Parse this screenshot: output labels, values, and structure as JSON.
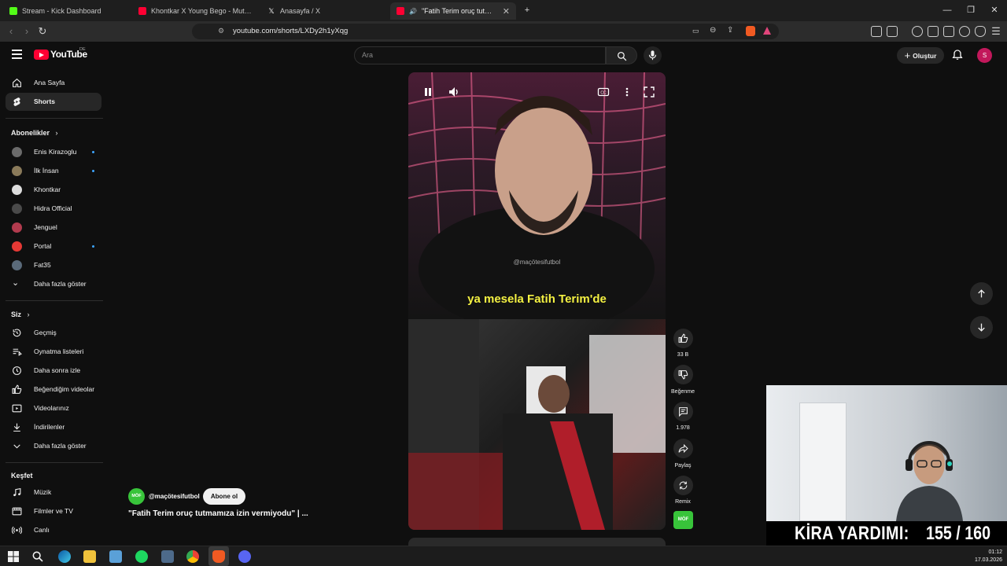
{
  "browser": {
    "tabs": [
      {
        "title": "Stream - Kick Dashboard",
        "color": "#53fc18"
      },
      {
        "title": "Khontkar X Young Bego - Mutfak I &",
        "color": "#ff0033"
      },
      {
        "title": "Anasayfa / X",
        "color": "#ffffff"
      },
      {
        "title": "\"Fatih Terim oruç tutmamıza i",
        "color": "#ff0033"
      }
    ],
    "url": "youtube.com/shorts/LXDy2h1yXqg"
  },
  "header": {
    "logo_text": "YouTube",
    "country": "DE",
    "search_placeholder": "Ara",
    "create_label": "Oluştur",
    "avatar_letter": "S"
  },
  "sidebar": {
    "main": [
      {
        "label": "Ana Sayfa",
        "icon": "home-icon"
      },
      {
        "label": "Shorts",
        "icon": "shorts-icon"
      }
    ],
    "subs_title": "Abonelikler",
    "subscriptions": [
      {
        "label": "Enis Kirazoglu",
        "dot": true,
        "color": "#6b6b6b"
      },
      {
        "label": "İlk İnsan",
        "dot": true,
        "color": "#8a7a5a"
      },
      {
        "label": "Khontkar",
        "dot": false,
        "color": "#dddddd"
      },
      {
        "label": "Hidra Official",
        "dot": false,
        "color": "#4a4a4a"
      },
      {
        "label": "Jenguel",
        "dot": false,
        "color": "#b23b4e"
      },
      {
        "label": "Portal",
        "dot": true,
        "color": "#e53935"
      },
      {
        "label": "Fat35",
        "dot": false,
        "color": "#5a6a7a"
      }
    ],
    "subs_more": "Daha fazla göster",
    "you_title": "Siz",
    "you_items": [
      {
        "label": "Geçmiş",
        "icon": "history-icon"
      },
      {
        "label": "Oynatma listeleri",
        "icon": "playlist-icon"
      },
      {
        "label": "Daha sonra izle",
        "icon": "clock-icon"
      },
      {
        "label": "Beğendiğim videolar",
        "icon": "like-icon"
      },
      {
        "label": "Videolarınız",
        "icon": "video-icon"
      },
      {
        "label": "İndirilenler",
        "icon": "download-icon"
      },
      {
        "label": "Daha fazla göster",
        "icon": "chevron-down-icon"
      }
    ],
    "explore_title": "Keşfet",
    "explore_items": [
      {
        "label": "Müzik",
        "icon": "music-icon"
      },
      {
        "label": "Filmler ve TV",
        "icon": "film-icon"
      },
      {
        "label": "Canlı",
        "icon": "live-icon"
      }
    ]
  },
  "short": {
    "watermark": "@maçötesifutbol",
    "subtitle": "ya mesela Fatih Terim'de",
    "channel": "@maçötesifutbol",
    "channel_badge": "MÖF",
    "subscribe_label": "Abone ol",
    "title": "\"Fatih Terim oruç tutmamıza izin vermiyodu\" | ...",
    "actions": {
      "like_count": "33 B",
      "dislike_label": "Beğenme",
      "comment_count": "1.978",
      "share_label": "Paylaş",
      "remix_label": "Remix"
    }
  },
  "overlay": {
    "kira_label": "KİRA YARDIMI:",
    "kira_value": "155 / 160"
  },
  "taskbar": {
    "time": "01:12",
    "date": "17.03.2026"
  }
}
